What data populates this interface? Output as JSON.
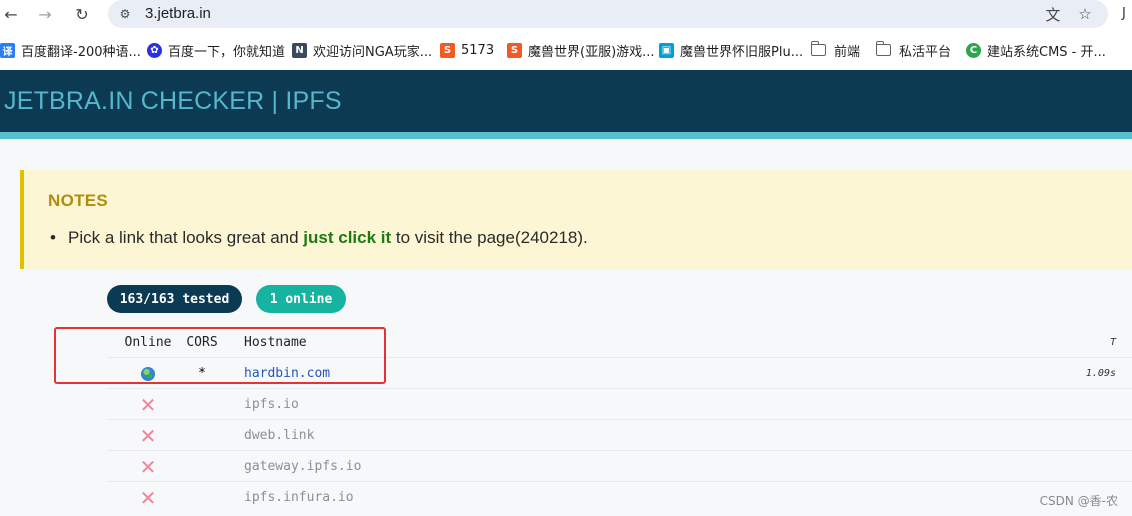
{
  "browser": {
    "back_icon": "arrow-left-icon",
    "forward_icon": "arrow-right-icon",
    "reload_icon": "reload-icon",
    "url": "3.jetbra.in",
    "translate_icon": "translate-icon",
    "bookmark_star_icon": "star-icon"
  },
  "bookmarks": [
    {
      "label": "百度翻译-200种语...",
      "icon": "译",
      "color": "#2b7cf6"
    },
    {
      "label": "百度一下，你就知道",
      "icon": "paw",
      "color": "#2932e1"
    },
    {
      "label": "欢迎访问NGA玩家...",
      "icon": "N",
      "color": "#3a4a5c"
    },
    {
      "label": "5173",
      "icon": "S",
      "color": "#f15a24"
    },
    {
      "label": "魔兽世界(亚服)游戏...",
      "icon": "S",
      "color": "#f15a24"
    },
    {
      "label": "魔兽世界怀旧服Plu...",
      "icon": "tv",
      "color": "#00a1d6"
    },
    {
      "label": "前端",
      "icon": "folder"
    },
    {
      "label": "私活平台",
      "icon": "folder"
    },
    {
      "label": "建站系统CMS - 开...",
      "icon": "C",
      "color": "#2ea44f"
    }
  ],
  "header": {
    "title": "JETBRA.IN CHECKER | IPFS"
  },
  "notes": {
    "title": "NOTES",
    "text_before": "Pick a link that looks great and ",
    "text_emphasis": "just click it",
    "text_after": " to visit the page(240218)."
  },
  "badges": {
    "tested": "163/163 tested",
    "online": "1 online"
  },
  "table": {
    "columns": [
      "Online",
      "CORS",
      "Hostname",
      "T"
    ],
    "rows": [
      {
        "status": "online",
        "cors": "*",
        "hostname": "hardbin.com",
        "time": "1.09s"
      },
      {
        "status": "offline",
        "cors": "",
        "hostname": "ipfs.io",
        "time": ""
      },
      {
        "status": "offline",
        "cors": "",
        "hostname": "dweb.link",
        "time": ""
      },
      {
        "status": "offline",
        "cors": "",
        "hostname": "gateway.ipfs.io",
        "time": ""
      },
      {
        "status": "offline",
        "cors": "",
        "hostname": "ipfs.infura.io",
        "time": ""
      }
    ]
  },
  "watermark": "CSDN @香-农"
}
